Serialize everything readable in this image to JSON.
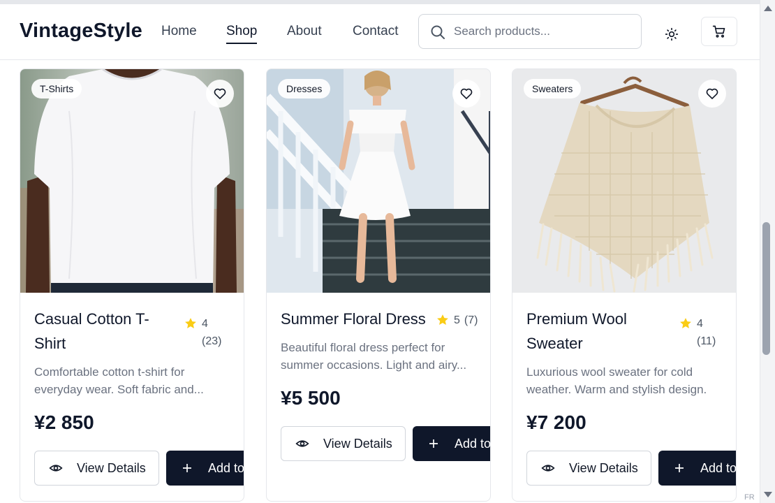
{
  "header": {
    "logo": "VintageStyle",
    "nav": [
      {
        "label": "Home",
        "active": false
      },
      {
        "label": "Shop",
        "active": true
      },
      {
        "label": "About",
        "active": false
      },
      {
        "label": "Contact",
        "active": false
      }
    ],
    "search": {
      "placeholder": "Search products...",
      "value": ""
    },
    "icons": {
      "search": "search-icon",
      "theme": "sun-icon",
      "cart": "cart-icon"
    }
  },
  "products": [
    {
      "category": "T-Shirts",
      "title": "Casual Cotton T-Shirt",
      "rating": "4",
      "reviews": "(23)",
      "description": "Comfortable cotton t-shirt for everyday wear. Soft fabric and...",
      "price": "¥2 850",
      "view_label": "View Details",
      "add_label": "Add to"
    },
    {
      "category": "Dresses",
      "title": "Summer Floral Dress",
      "rating": "5",
      "reviews": "(7)",
      "description": "Beautiful floral dress perfect for summer occasions. Light and airy...",
      "price": "¥5 500",
      "view_label": "View Details",
      "add_label": "Add to"
    },
    {
      "category": "Sweaters",
      "title": "Premium Wool Sweater",
      "rating": "4",
      "reviews": "(11)",
      "description": "Luxurious wool sweater for cold weather. Warm and stylish design.",
      "price": "¥7 200",
      "view_label": "View Details",
      "add_label": "Add to"
    }
  ],
  "colors": {
    "primary": "#0f172a",
    "star": "#facc15",
    "muted_text": "#6b7280",
    "border": "#e5e7eb"
  },
  "locale": "FR"
}
